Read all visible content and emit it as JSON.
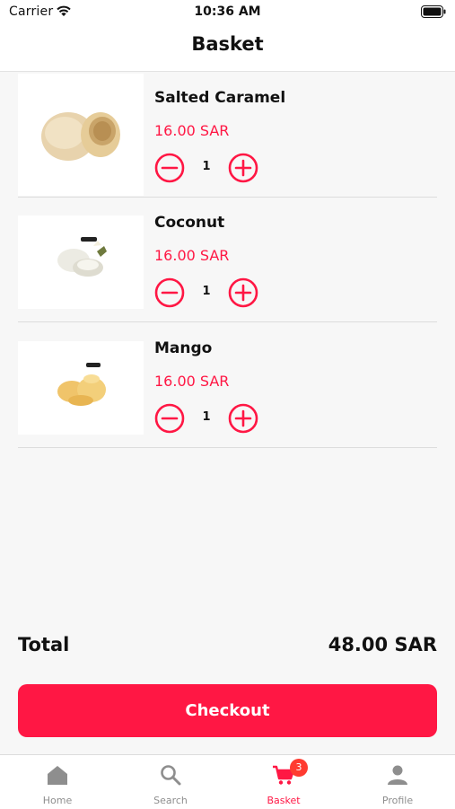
{
  "status_bar": {
    "carrier": "Carrier",
    "time": "10:36 AM"
  },
  "header": {
    "title": "Basket"
  },
  "items": [
    {
      "name": "Salted Caramel",
      "price": "16.00 SAR",
      "quantity": "1",
      "image": "salted-caramel-mochi"
    },
    {
      "name": "Coconut",
      "price": "16.00 SAR",
      "quantity": "1",
      "image": "coconut-mochi"
    },
    {
      "name": "Mango",
      "price": "16.00 SAR",
      "quantity": "1",
      "image": "mango-mochi"
    }
  ],
  "summary": {
    "total_label": "Total",
    "total_value": "48.00 SAR"
  },
  "checkout": {
    "label": "Checkout"
  },
  "tab_bar": {
    "tabs": [
      {
        "label": "Home",
        "icon": "home-icon",
        "active": false
      },
      {
        "label": "Search",
        "icon": "search-icon",
        "active": false
      },
      {
        "label": "Basket",
        "icon": "cart-icon",
        "active": true,
        "badge": "3"
      },
      {
        "label": "Profile",
        "icon": "person-icon",
        "active": false
      }
    ]
  },
  "colors": {
    "accent": "#ff1744",
    "background": "#f7f7f7",
    "inactive": "#8e8e8e"
  }
}
